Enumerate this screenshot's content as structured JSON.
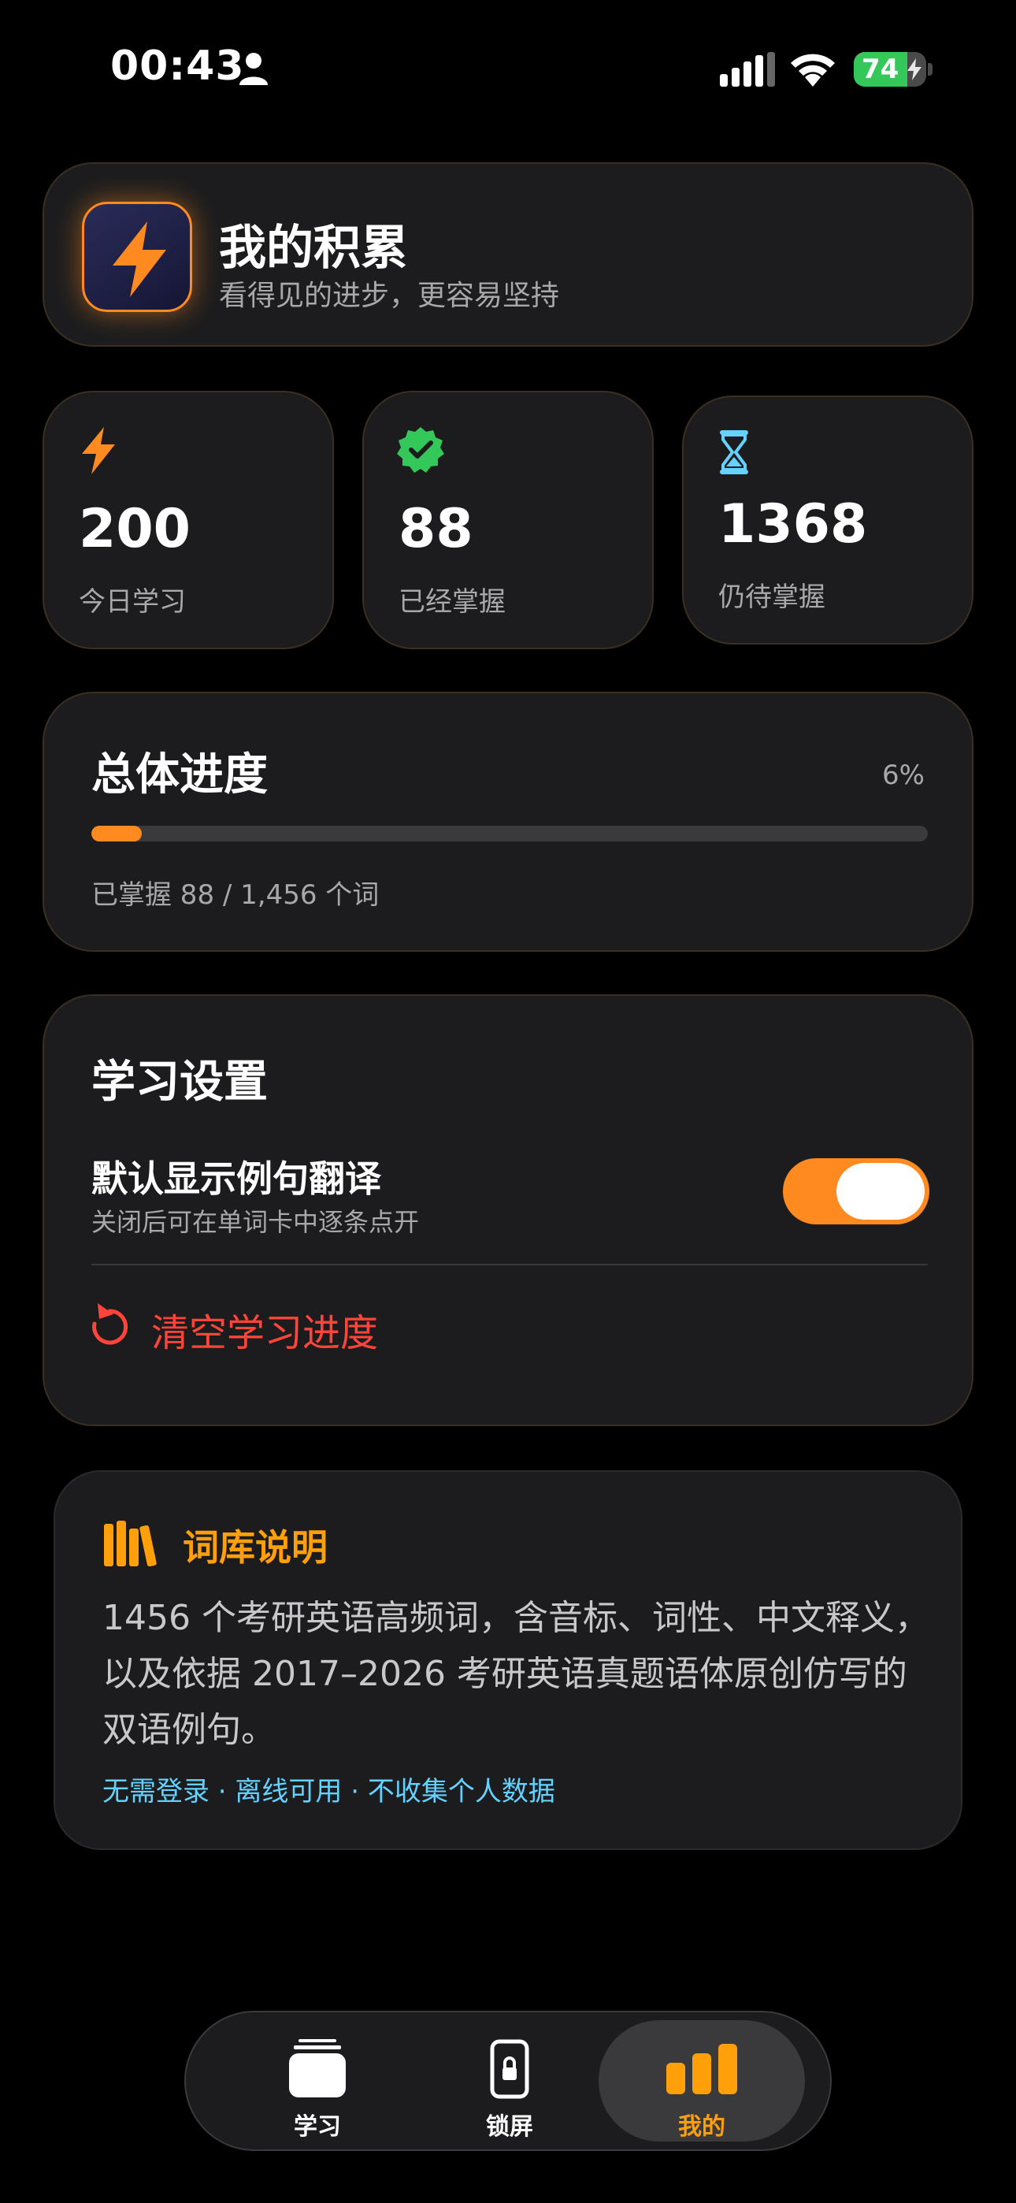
{
  "status_bar": {
    "time": "00:43",
    "battery_level": "74",
    "battery_fraction": 0.74
  },
  "header": {
    "title": "我的积累",
    "subtitle": "看得见的进步，更容易坚持",
    "icon": "lightning-icon"
  },
  "stats": [
    {
      "value": "200",
      "label": "今日学习",
      "icon": "lightning-icon",
      "color": "#ff8a1f"
    },
    {
      "value": "88",
      "label": "已经掌握",
      "icon": "check-seal-icon",
      "color": "#34c759"
    },
    {
      "value": "1368",
      "label": "仍待掌握",
      "icon": "hourglass-icon",
      "color": "#64d2ff"
    }
  ],
  "progress": {
    "title": "总体进度",
    "percent_label": "6%",
    "fraction": 0.06,
    "caption": "已掌握 88 / 1,456 个词"
  },
  "settings": {
    "title": "学习设置",
    "translation_toggle": {
      "title": "默认显示例句翻译",
      "description": "关闭后可在单词卡中逐条点开",
      "on": true
    },
    "reset_label": "清空学习进度"
  },
  "info": {
    "title": "词库说明",
    "body": "1456 个考研英语高频词，含音标、词性、中文释义，以及依据 2017–2026 考研英语真题语体原创仿写的双语例句。",
    "footer": "无需登录 · 离线可用 · 不收集个人数据"
  },
  "tabs": [
    {
      "label": "学习",
      "icon": "cards-icon",
      "active": false
    },
    {
      "label": "锁屏",
      "icon": "lock-phone-icon",
      "active": false
    },
    {
      "label": "我的",
      "icon": "bar-chart-icon",
      "active": true
    }
  ],
  "colors": {
    "accent": "#ff8a1f",
    "success": "#34c759",
    "info": "#64d2ff",
    "danger": "#ff453a",
    "title_accent": "#ff9f0a"
  }
}
